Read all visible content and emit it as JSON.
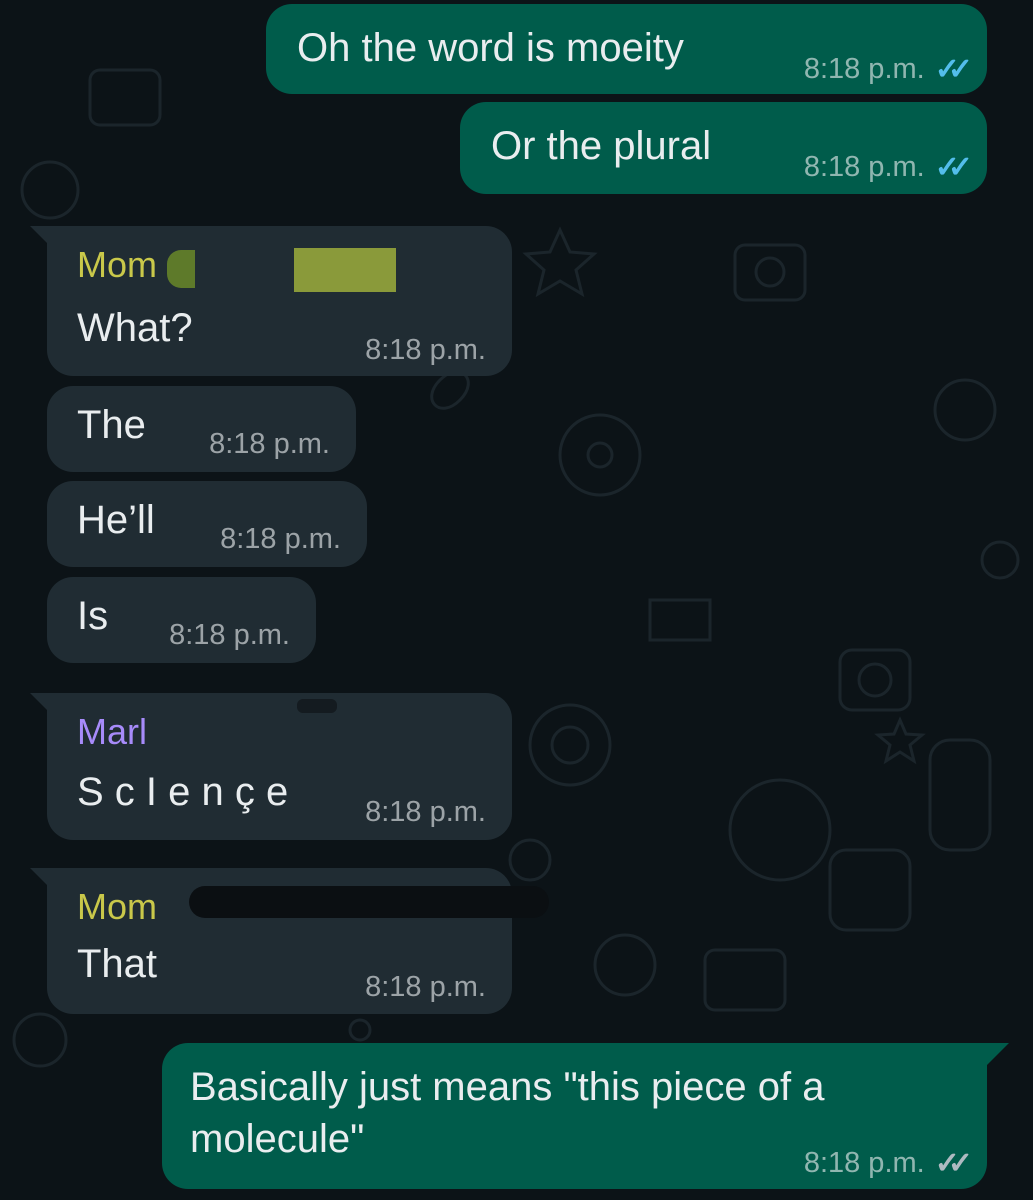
{
  "colors": {
    "background": "#0c1317",
    "outgoing_bubble": "#005c4b",
    "incoming_bubble": "#202c33",
    "read_tick": "#53bdeb",
    "sent_tick": "#aebac1",
    "sender_mom": "#c9c84a",
    "sender_mark": "#a78bfa"
  },
  "messages": [
    {
      "text": "Oh the word is moeity",
      "time": "8:18 p.m.",
      "ticks": "read-ticks-icon"
    },
    {
      "text": "Or the plural",
      "time": "8:18 p.m.",
      "ticks": "read-ticks-icon"
    },
    {
      "sender": "Mom",
      "text": "What?",
      "time": "8:18 p.m."
    },
    {
      "text": "The",
      "time": "8:18 p.m."
    },
    {
      "text": "He’ll",
      "time": "8:18 p.m."
    },
    {
      "text": "Is",
      "time": "8:18 p.m."
    },
    {
      "sender": "Marl",
      "text": "S c I e n ç e",
      "time": "8:18 p.m."
    },
    {
      "sender": "Mom",
      "text": "That",
      "time": "8:18 p.m."
    },
    {
      "text_line1": "Basically just means \"this piece of a",
      "text_line2": "molecule\"",
      "time": "8:18 p.m.",
      "ticks": "delivered-ticks-icon"
    }
  ]
}
